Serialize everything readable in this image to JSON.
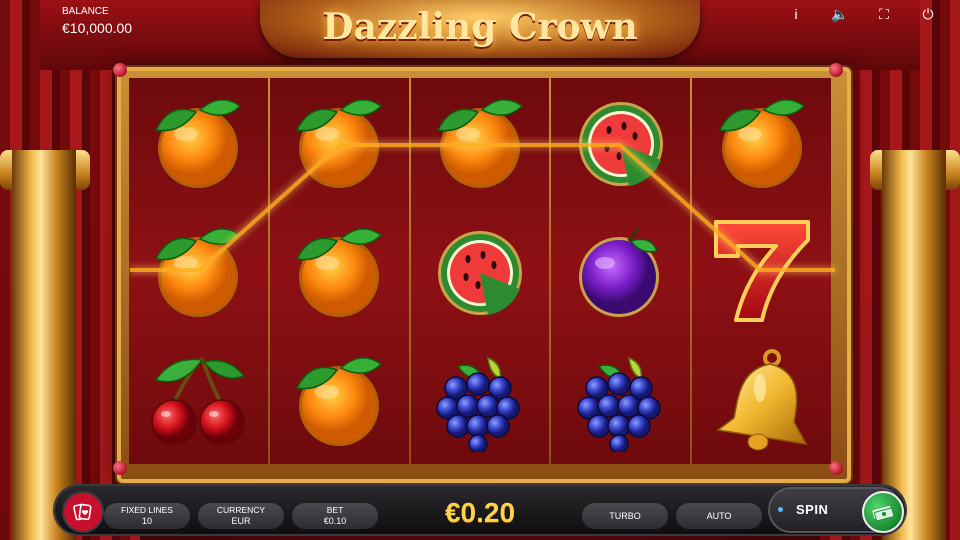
{
  "game": {
    "title": "Dazzling Crown"
  },
  "balance": {
    "label": "BALANCE",
    "value": "€10,000.00"
  },
  "top_controls": [
    {
      "name": "info-icon",
      "glyph": "i"
    },
    {
      "name": "sound-icon",
      "glyph": "🔈"
    },
    {
      "name": "fullscreen-icon",
      "glyph": "⛶"
    },
    {
      "name": "power-icon",
      "glyph": "⏻"
    }
  ],
  "reels": [
    [
      "orange",
      "orange",
      "cherry"
    ],
    [
      "orange",
      "orange",
      "orange"
    ],
    [
      "orange",
      "watermelon",
      "grapes"
    ],
    [
      "watermelon",
      "plum",
      "grapes"
    ],
    [
      "orange",
      "seven",
      "bell"
    ]
  ],
  "bottom_bar": {
    "fixed_lines": {
      "label": "FIXED LINES",
      "value": "10"
    },
    "currency": {
      "label": "CURRENCY",
      "value": "EUR"
    },
    "bet": {
      "label": "BET",
      "value": "€0.10"
    },
    "total_bet": "€0.20",
    "turbo_label": "TURBO",
    "auto_label": "AUTO",
    "spin_label": "SPIN"
  },
  "colors": {
    "accent_gold": "#ffd24a",
    "frame_gold": "#e8ac4a",
    "payline": "#ffb020",
    "spin_green": "#1a8a30"
  }
}
